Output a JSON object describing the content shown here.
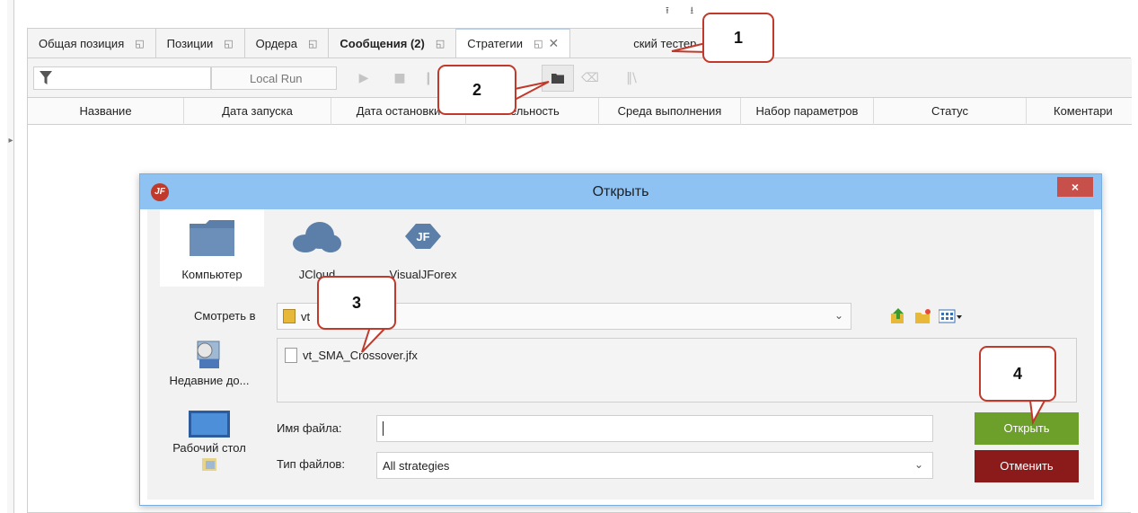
{
  "top_controls": "⭱ ⭳",
  "tabs": [
    {
      "label": "Общая позиция",
      "bold": false
    },
    {
      "label": "Позиции",
      "bold": false
    },
    {
      "label": "Ордера",
      "bold": false
    },
    {
      "label": "Сообщения (2)",
      "bold": true
    },
    {
      "label": "Стратегии",
      "bold": false,
      "active": true
    },
    {
      "label": "ский тестер",
      "bold": false
    }
  ],
  "toolbar": {
    "run_mode": "Local Run"
  },
  "columns": [
    "Название",
    "Дата запуска",
    "Дата остановки",
    "тельность",
    "Среда выполнения",
    "Набор параметров",
    "Статус",
    "Коментари"
  ],
  "dialog": {
    "title": "Открыть",
    "close_symbol": "×",
    "places": [
      "Компьютер",
      "JCloud",
      "VisualJForex"
    ],
    "look_in_label": "Смотреть в",
    "look_in_value": "vt",
    "files": [
      "vt_SMA_Crossover.jfx"
    ],
    "side_items": [
      "Недавние до...",
      "Рабочий стол"
    ],
    "file_name_label": "Имя файла:",
    "file_name_value": "",
    "file_type_label": "Тип файлов:",
    "file_type_value": "All strategies",
    "ok_label": "Открыть",
    "cancel_label": "Отменить"
  },
  "callouts": [
    "1",
    "2",
    "3",
    "4"
  ],
  "colors": {
    "dialog_title_bg": "#8ec2f2",
    "ok_button": "#6d9f2b",
    "cancel_button": "#8b1a1a",
    "callout_border": "#c0392b",
    "close_button": "#c7504a"
  }
}
